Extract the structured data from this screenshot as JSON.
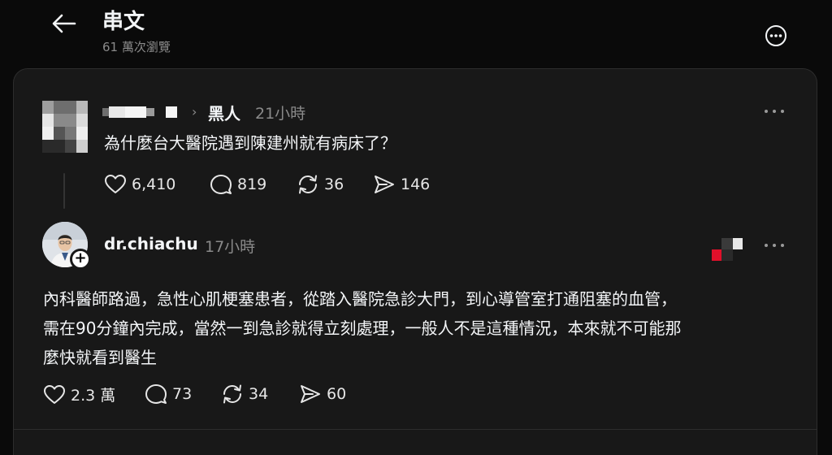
{
  "header": {
    "title": "串文",
    "views": "61 萬次瀏覽"
  },
  "post1": {
    "topic": "黑人",
    "time": "21小時",
    "text": "為什麼台大醫院遇到陳建州就有病床了？",
    "likes": "6,410",
    "comments": "819",
    "reposts": "36",
    "shares": "146"
  },
  "post2": {
    "username": "dr.chiachu",
    "time": "17小時",
    "text_lines": [
      "內科醫師路過，急性心肌梗塞患者，從踏入醫院急診大門，到心導管室打通阻塞的血管，",
      "需在90分鐘內完成，當然一到急診就得立刻處理，一般人不是這種情況，本來就不可能那",
      "麼快就看到醫生"
    ],
    "likes": "2.3 萬",
    "comments": "73",
    "reposts": "34",
    "shares": "60"
  },
  "icons": {
    "back": "arrow-left-icon",
    "more": "more-horizontal-icon",
    "like": "heart-icon",
    "comment": "comment-icon",
    "repost": "repost-icon",
    "share": "send-icon"
  },
  "colors": {
    "background": "#0a0a0a",
    "card": "#181818",
    "muted_text": "#8a8a8a",
    "badge_red": "#e0102a"
  }
}
